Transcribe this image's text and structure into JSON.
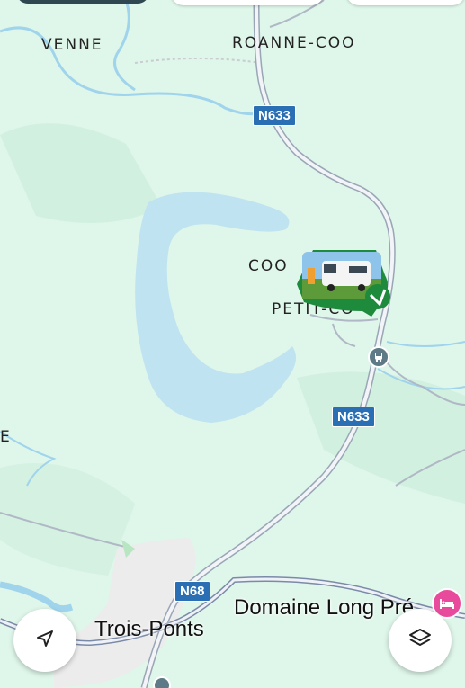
{
  "map": {
    "places": {
      "venne": "VENNE",
      "roanne_coo": "ROANNE-COO",
      "coo": "COO",
      "petit_coo": "PETIT-CO",
      "edge_e": "E"
    },
    "towns": {
      "trois_ponts": "Trois-Ponts",
      "domaine": "Domaine Long Pré"
    },
    "roads": {
      "n633_top": "N633",
      "n633_mid": "N633",
      "n68": "N68"
    },
    "markers": {
      "pin_icon": "camper-van-photo-pin",
      "hotel_icon": "hotel-bed-icon",
      "bus_icon": "bus-stop-icon"
    },
    "colors": {
      "land": "#dff6ea",
      "water": "#bfe3f0",
      "river": "#8ecbe6",
      "road_shield": "#2a6fb3",
      "pin": "#1e8a3c",
      "hotel": "#e84a9c"
    }
  },
  "controls": {
    "locate_icon": "navigation-arrow-icon",
    "layers_icon": "layers-icon"
  }
}
